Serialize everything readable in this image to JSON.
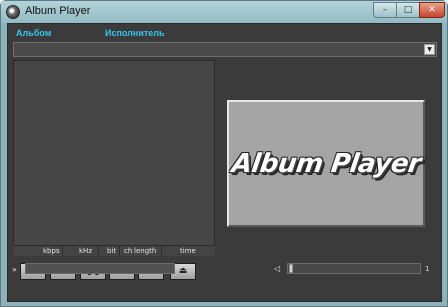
{
  "window": {
    "title": "Album Player",
    "controls": {
      "minimize": "–",
      "maximize": "□",
      "close": "✕"
    }
  },
  "header": {
    "album_label": "Альбом",
    "artist_label": "Исполнитель"
  },
  "album_select": {
    "selected": "",
    "arrow_icon": "chevron-down-icon"
  },
  "track_info": {
    "columns": [
      "kbps",
      "kHz",
      "bit",
      "ch",
      "length",
      "time"
    ]
  },
  "logo": {
    "text": "Album Player"
  },
  "transport": {
    "buttons": [
      {
        "name": "previous",
        "glyph": "⏮"
      },
      {
        "name": "stop",
        "glyph": "■"
      },
      {
        "name": "pause",
        "glyph": "❚❚"
      },
      {
        "name": "play",
        "glyph": "▶"
      },
      {
        "name": "next",
        "glyph": "⏭"
      },
      {
        "name": "eject",
        "glyph": "⏏"
      }
    ]
  },
  "progress": {
    "icon": "»",
    "fraction": 0.0
  },
  "volume": {
    "icon": "◁",
    "value": "1",
    "fraction": 0.0
  }
}
